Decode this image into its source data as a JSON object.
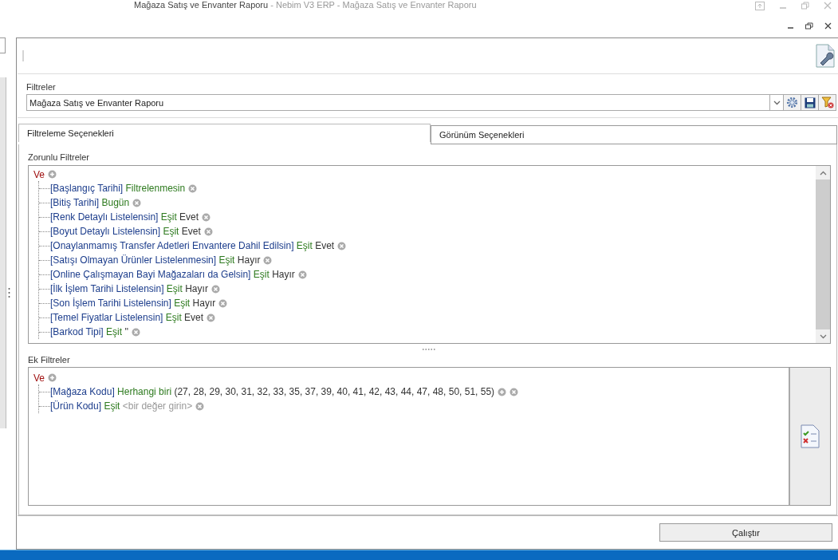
{
  "window": {
    "title": "Mağaza Satış ve Envanter Raporu",
    "app_title": "- Nebim V3 ERP - Mağaza Satış ve Envanter Raporu"
  },
  "filters": {
    "label": "Filtreler",
    "value": "Mağaza Satış ve Envanter Raporu"
  },
  "tabs": [
    {
      "label": "Filtreleme Seçenekleri",
      "selected": true
    },
    {
      "label": "Görünüm Seçenekleri",
      "selected": false
    }
  ],
  "mandatory_filters": {
    "label": "Zorunlu Filtreler",
    "root": "Ve",
    "items": [
      {
        "field": "[Başlangıç Tarihi]",
        "operator": "Filtrelenmesin"
      },
      {
        "field": "[Bitiş Tarihi]",
        "operator": "Bugün"
      },
      {
        "field": "[Renk Detaylı Listelensin]",
        "operator": "Eşit",
        "value": "Evet"
      },
      {
        "field": "[Boyut Detaylı Listelensin]",
        "operator": "Eşit",
        "value": "Evet"
      },
      {
        "field": "[Onaylanmamış Transfer Adetleri Envantere Dahil Edilsin]",
        "operator": "Eşit",
        "value": "Evet"
      },
      {
        "field": "[Satışı Olmayan Ürünler Listelenmesin]",
        "operator": "Eşit",
        "value": "Hayır"
      },
      {
        "field": "[Online Çalışmayan Bayi Mağazaları da Gelsin]",
        "operator": "Eşit",
        "value": "Hayır"
      },
      {
        "field": "[İlk İşlem Tarihi Listelensin]",
        "operator": "Eşit",
        "value": "Hayır"
      },
      {
        "field": "[Son İşlem Tarihi Listelensin]",
        "operator": "Eşit",
        "value": "Hayır"
      },
      {
        "field": "[Temel Fiyatlar Listelensin]",
        "operator": "Eşit",
        "value": "Evet"
      },
      {
        "field": "[Barkod Tipi]",
        "operator": "Eşit",
        "value": "''"
      }
    ]
  },
  "extra_filters": {
    "label": "Ek Filtreler",
    "root": "Ve",
    "items": [
      {
        "field": "[Mağaza Kodu]",
        "operator": "Herhangi biri",
        "value": "(27, 28, 29, 30, 31, 32, 33, 35, 37, 39, 40, 41, 42, 43, 44, 47, 48, 50, 51, 55)",
        "kind": "list"
      },
      {
        "field": "[Ürün Kodu]",
        "operator": "Eşit",
        "value": "<bir değer girin>",
        "kind": "prompt"
      }
    ]
  },
  "run_button": "Çalıştır"
}
